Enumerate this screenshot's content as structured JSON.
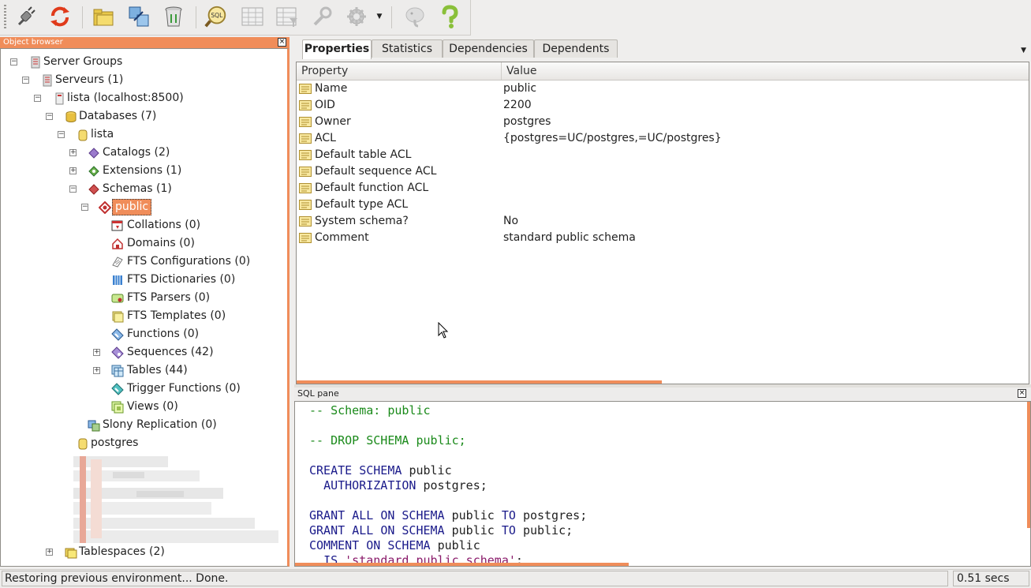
{
  "toolbar": {
    "buttons": [
      {
        "name": "connect",
        "icon": "plug-icon"
      },
      {
        "name": "refresh",
        "icon": "refresh-icon"
      },
      {
        "name": "create-object",
        "icon": "folder-new-icon"
      },
      {
        "name": "properties",
        "icon": "properties-icon"
      },
      {
        "name": "delete",
        "icon": "trash-icon"
      },
      {
        "name": "sql-query",
        "icon": "sql-magnifier-icon"
      },
      {
        "name": "view-data",
        "icon": "table-icon"
      },
      {
        "name": "filtered-data",
        "icon": "table-filter-icon"
      },
      {
        "name": "maintenance",
        "icon": "wrench-icon"
      },
      {
        "name": "plugins",
        "icon": "puzzle-icon"
      },
      {
        "name": "hint",
        "icon": "elephant-icon"
      },
      {
        "name": "help",
        "icon": "help-icon"
      }
    ],
    "sql_label": "SQL"
  },
  "object_browser": {
    "title": "Object browser",
    "nodes": [
      {
        "label": "Server Groups",
        "icon": "server-groups-icon"
      },
      {
        "label": "Serveurs (1)",
        "icon": "servers-icon"
      },
      {
        "label": "lista (localhost:8500)",
        "icon": "server-icon"
      },
      {
        "label": "Databases (7)",
        "icon": "databases-icon"
      },
      {
        "label": "lista",
        "icon": "database-icon"
      },
      {
        "label": "Catalogs (2)",
        "icon": "catalogs-icon"
      },
      {
        "label": "Extensions (1)",
        "icon": "extensions-icon"
      },
      {
        "label": "Schemas (1)",
        "icon": "schemas-icon"
      },
      {
        "label": "public",
        "icon": "schema-icon"
      },
      {
        "label": "Collations (0)",
        "icon": "collations-icon"
      },
      {
        "label": "Domains (0)",
        "icon": "domains-icon"
      },
      {
        "label": "FTS Configurations (0)",
        "icon": "fts-config-icon"
      },
      {
        "label": "FTS Dictionaries (0)",
        "icon": "fts-dict-icon"
      },
      {
        "label": "FTS Parsers (0)",
        "icon": "fts-parser-icon"
      },
      {
        "label": "FTS Templates (0)",
        "icon": "fts-template-icon"
      },
      {
        "label": "Functions (0)",
        "icon": "functions-icon"
      },
      {
        "label": "Sequences (42)",
        "icon": "sequences-icon"
      },
      {
        "label": "Tables (44)",
        "icon": "tables-icon"
      },
      {
        "label": "Trigger Functions (0)",
        "icon": "trigger-functions-icon"
      },
      {
        "label": "Views (0)",
        "icon": "views-icon"
      },
      {
        "label": "Slony Replication (0)",
        "icon": "slony-icon"
      },
      {
        "label": "postgres",
        "icon": "database-icon"
      },
      {
        "label": "Tablespaces (2)",
        "icon": "tablespaces-icon"
      }
    ]
  },
  "properties": {
    "tabs": [
      "Properties",
      "Statistics",
      "Dependencies",
      "Dependents"
    ],
    "active_tab": "Properties",
    "columns": [
      "Property",
      "Value"
    ],
    "rows": [
      {
        "property": "Name",
        "value": "public"
      },
      {
        "property": "OID",
        "value": "2200"
      },
      {
        "property": "Owner",
        "value": "postgres"
      },
      {
        "property": "ACL",
        "value": "{postgres=UC/postgres,=UC/postgres}"
      },
      {
        "property": "Default table ACL",
        "value": ""
      },
      {
        "property": "Default sequence ACL",
        "value": ""
      },
      {
        "property": "Default function ACL",
        "value": ""
      },
      {
        "property": "Default type ACL",
        "value": ""
      },
      {
        "property": "System schema?",
        "value": "No"
      },
      {
        "property": "Comment",
        "value": "standard public schema"
      }
    ]
  },
  "sql_pane": {
    "title": "SQL pane",
    "lines": [
      "-- Schema: public",
      "",
      "-- DROP SCHEMA public;",
      "",
      "CREATE SCHEMA public",
      "  AUTHORIZATION postgres;",
      "",
      "GRANT ALL ON SCHEMA public TO postgres;",
      "GRANT ALL ON SCHEMA public TO public;",
      "COMMENT ON SCHEMA public",
      "  IS 'standard public schema';"
    ]
  },
  "status": {
    "message": "Restoring previous environment... Done.",
    "time": "0.51 secs"
  },
  "colors": {
    "accent": "#f08d5a",
    "comment": "#1a8a1a",
    "keyword": "#1a1a8a",
    "string": "#8a1a6a"
  }
}
